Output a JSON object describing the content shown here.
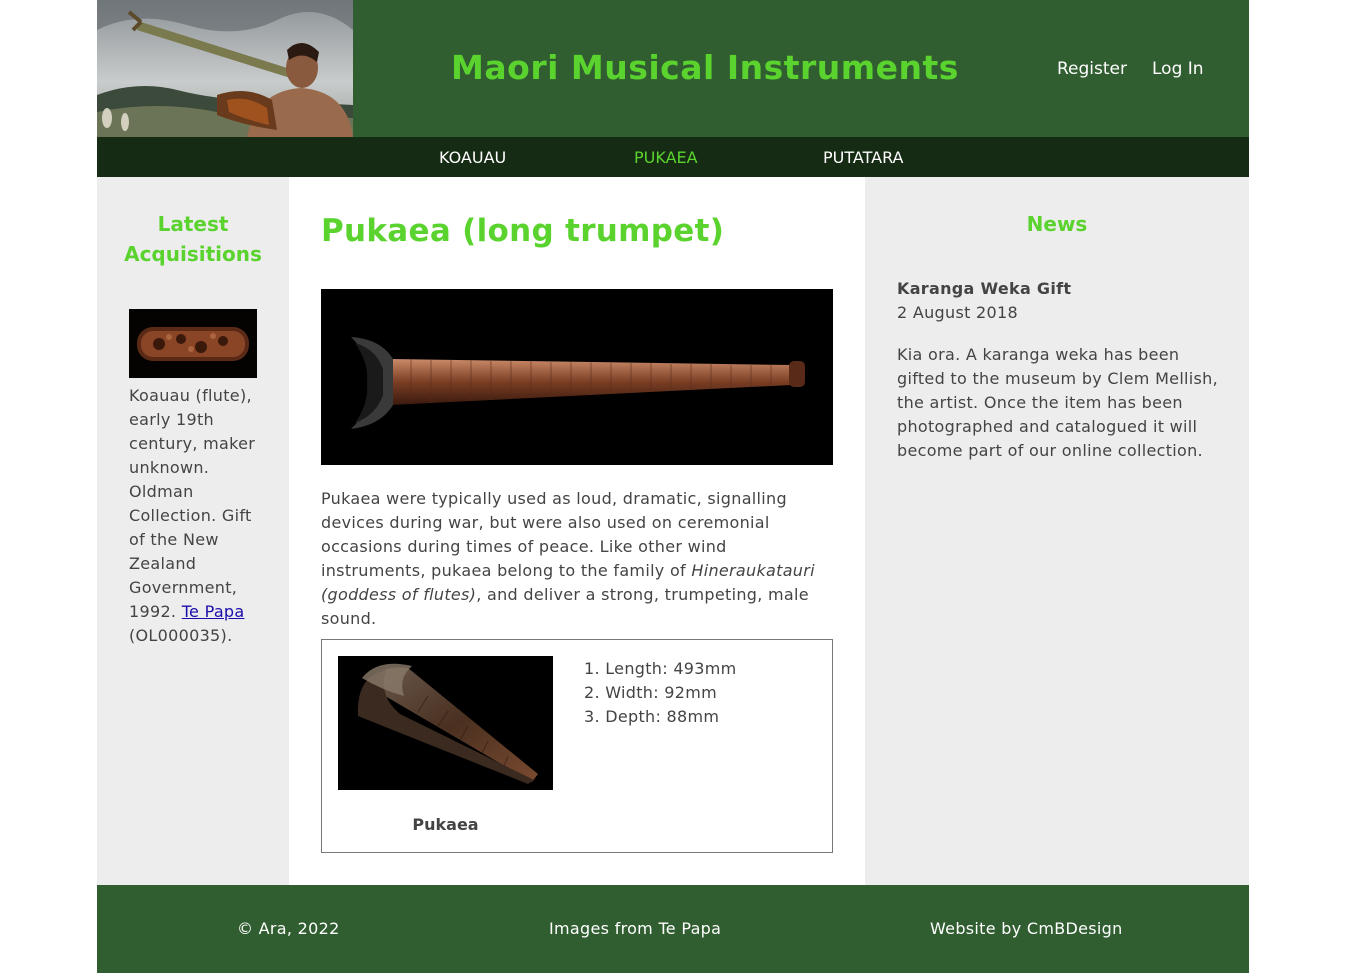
{
  "header": {
    "title": "Maori Musical Instruments",
    "register": "Register",
    "login": "Log In",
    "brand_color": "#315e31",
    "accent_color": "#5bd32e"
  },
  "nav": {
    "items": [
      {
        "label": "KOAUAU"
      },
      {
        "label": "PUKAEA",
        "active": true
      },
      {
        "label": "PUTATARA"
      }
    ]
  },
  "left": {
    "heading": "Latest Acquisitions",
    "caption_pre": "Koauau (flute), early 19th century, maker unknown. Oldman Collection. Gift of the New Zealand Government, 1992. ",
    "caption_link": "Te Papa",
    "caption_post": " (OL000035)."
  },
  "main": {
    "title": "Pukaea (long trumpet)",
    "text_pre": "Pukaea were typically used as loud, dramatic, signalling devices during war, but were also used on ceremonial occasions during times of peace. Like other wind instruments, pukaea belong to the family of ",
    "text_em": "Hineraukatauri (goddess of flutes)",
    "text_post": ", and deliver a strong, trumpeting, male sound.",
    "spec": {
      "caption": "Pukaea",
      "items": [
        "1. Length: 493mm",
        "2. Width: 92mm",
        "3. Depth: 88mm"
      ]
    }
  },
  "right": {
    "heading": "News",
    "news_title": "Karanga Weka Gift",
    "news_date": "2 August 2018",
    "news_body": "Kia ora. A karanga weka has been gifted to the museum by Clem Mellish, the artist. Once the item has been photographed and catalogued it will become part of our online collection."
  },
  "footer": {
    "copyright": "© Ara, 2022",
    "images": "Images from Te Papa",
    "credit": "Website by CmBDesign"
  }
}
